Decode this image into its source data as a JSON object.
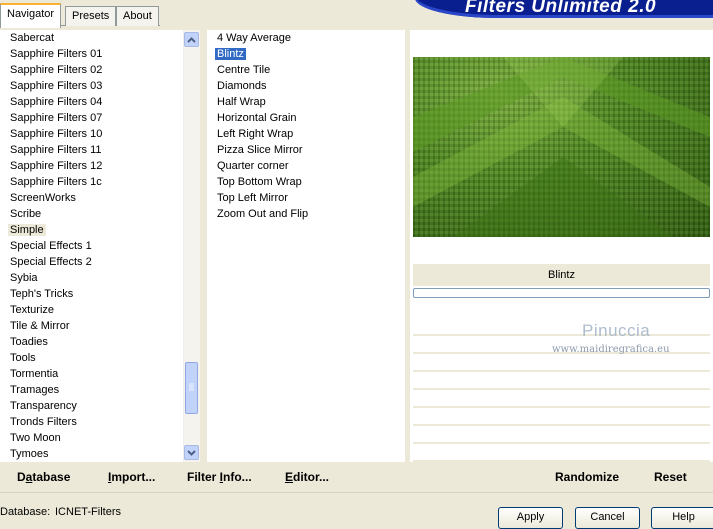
{
  "tabs": [
    {
      "label": "Navigator",
      "active": true
    },
    {
      "label": "Presets",
      "active": false
    },
    {
      "label": "About",
      "active": false
    }
  ],
  "banner_title": "Filters Unlimited 2.0",
  "categories": [
    "Sabercat",
    "Sapphire Filters 01",
    "Sapphire Filters 02",
    "Sapphire Filters 03",
    "Sapphire Filters 04",
    "Sapphire Filters 07",
    "Sapphire Filters 10",
    "Sapphire Filters 11",
    "Sapphire Filters 12",
    "Sapphire Filters 1c",
    "ScreenWorks",
    "Scribe",
    "Simple",
    "Special Effects 1",
    "Special Effects 2",
    "Sybia",
    "Teph's Tricks",
    "Texturize",
    "Tile & Mirror",
    "Toadies",
    "Tools",
    "Tormentia",
    "Tramages",
    "Transparency",
    "Tronds Filters",
    "Two Moon",
    "Tymoes"
  ],
  "selected_category": "Simple",
  "filters": [
    "4 Way Average",
    "Blintz",
    "Centre Tile",
    "Diamonds",
    "Half Wrap",
    "Horizontal Grain",
    "Left Right Wrap",
    "Pizza Slice Mirror",
    "Quarter corner",
    "Top Bottom Wrap",
    "Top Left Mirror",
    "Zoom Out and Flip"
  ],
  "selected_filter": "Blintz",
  "preview_filter_name": "Blintz",
  "watermark": {
    "title": "Pinuccia",
    "url": "www.maidiregrafica.eu"
  },
  "bottom_buttons": {
    "database": {
      "pre": "D",
      "u": "a",
      "post": "tabase"
    },
    "import": {
      "pre": "",
      "u": "I",
      "post": "mport..."
    },
    "filter_info": {
      "pre": "Filter ",
      "u": "I",
      "post": "nfo..."
    },
    "editor": {
      "pre": "",
      "u": "E",
      "post": "ditor..."
    },
    "randomize": "Randomize",
    "reset": "Reset"
  },
  "database_label": "Database:",
  "database_value": "ICNET-Filters",
  "dialog_buttons": {
    "apply": "Apply",
    "cancel": "Cancel",
    "help": "Help"
  },
  "colors": {
    "selection": "#316ac5",
    "banner": "#0a1f8f",
    "dialog_bg": "#ece9d8"
  }
}
